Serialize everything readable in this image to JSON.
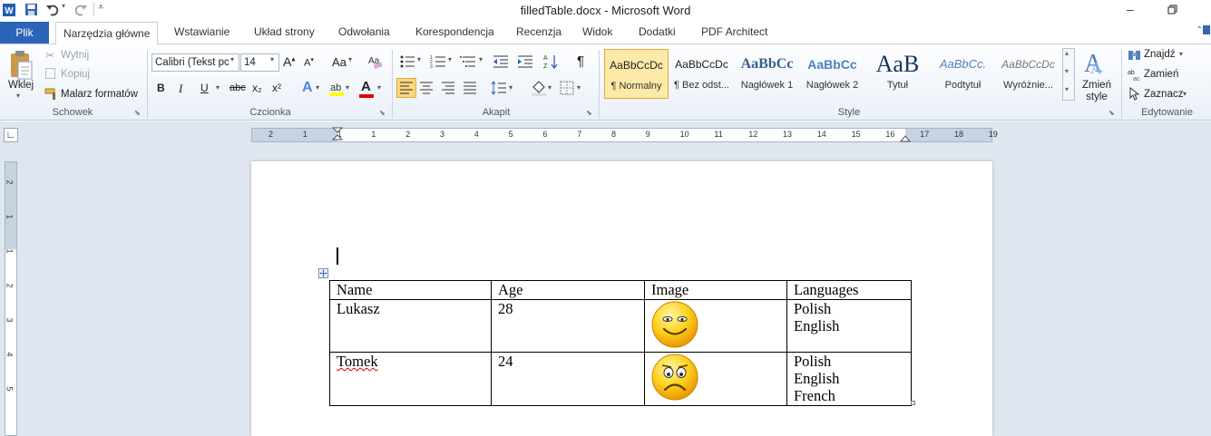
{
  "window": {
    "title": "filledTable.docx - Microsoft Word"
  },
  "qat": {
    "word_icon": "word-icon",
    "save_icon": "save-icon",
    "undo_icon": "undo-icon",
    "redo_icon": "repeat-icon"
  },
  "tabs": {
    "file": "Plik",
    "items": [
      "Narzędzia główne",
      "Wstawianie",
      "Układ strony",
      "Odwołania",
      "Korespondencja",
      "Recenzja",
      "Widok",
      "Dodatki",
      "PDF Architect"
    ]
  },
  "clipboard": {
    "paste": "Wklej",
    "cut": "Wytnij",
    "copy": "Kopiuj",
    "format_painter": "Malarz formatów",
    "label": "Schowek"
  },
  "font": {
    "name": "Calibri (Tekst pc",
    "size": "14",
    "label": "Czcionka",
    "change_case": "Aa",
    "bold": "B",
    "italic": "I",
    "underline": "U",
    "strike": "abc",
    "subscript": "x₂",
    "superscript": "x²",
    "color_a": "A"
  },
  "paragraph": {
    "label": "Akapit",
    "pilcrow": "¶"
  },
  "styles": {
    "label": "Style",
    "items": [
      {
        "sample": "AaBbCcDc",
        "name": "¶ Normalny"
      },
      {
        "sample": "AaBbCcDc",
        "name": "¶ Bez odst..."
      },
      {
        "sample": "AaBbCc",
        "name": "Nagłówek 1"
      },
      {
        "sample": "AaBbCc",
        "name": "Nagłówek 2"
      },
      {
        "sample": "AaB",
        "name": "Tytuł"
      },
      {
        "sample": "AaBbCc.",
        "name": "Podtytuł"
      },
      {
        "sample": "AaBbCcDc",
        "name": "Wyróżnie..."
      }
    ],
    "change_styles": "Zmień style"
  },
  "editing": {
    "label": "Edytowanie",
    "find": "Znajdź",
    "replace": "Zamień",
    "select": "Zaznacz"
  },
  "ruler": {
    "numbers": [
      "2",
      "1",
      "1",
      "1",
      "2",
      "3",
      "4",
      "5",
      "6",
      "7",
      "8",
      "9",
      "10",
      "11",
      "12",
      "13",
      "14",
      "15",
      "16",
      "17",
      "18",
      "19"
    ],
    "vnumbers": [
      "2",
      "1",
      "1",
      "2",
      "3",
      "4",
      "5"
    ]
  },
  "document": {
    "table": {
      "headers": [
        "Name",
        "Age",
        "Image",
        "Languages"
      ],
      "rows": [
        {
          "name": "Lukasz",
          "age": "28",
          "image": "smiling-face-icon",
          "languages": [
            "Polish",
            "English"
          ]
        },
        {
          "name": "Tomek",
          "age": "24",
          "image": "worried-face-icon",
          "languages": [
            "Polish",
            "English",
            "French"
          ]
        }
      ]
    }
  },
  "colors": {
    "file_tab": "#2b64b8",
    "workspace": "#dfe6ef",
    "highlight": "#ffff00",
    "font_color": "#e00000"
  }
}
